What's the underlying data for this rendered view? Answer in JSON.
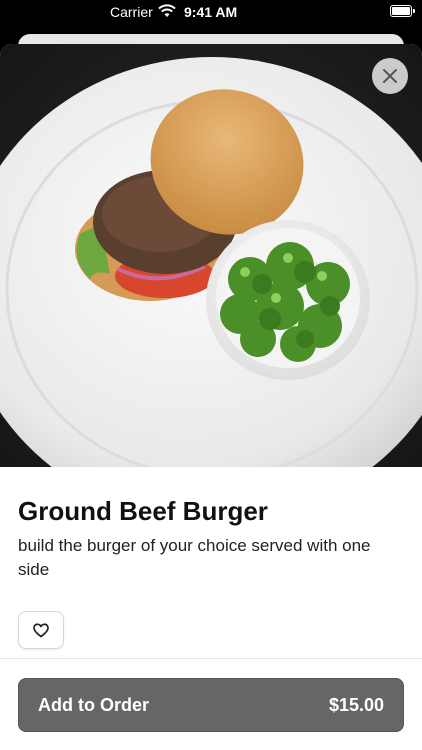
{
  "status_bar": {
    "carrier": "Carrier",
    "time": "9:41 AM"
  },
  "item": {
    "title": "Ground Beef Burger",
    "description": "build the burger of your choice served with one side",
    "image_alt": "burger with broccoli on plate"
  },
  "actions": {
    "add_label": "Add to Order",
    "price": "$15.00"
  },
  "icons": {
    "close": "close-icon",
    "favorite": "heart-icon",
    "wifi": "wifi-icon",
    "battery": "battery-icon"
  },
  "colors": {
    "order_button": "#666666",
    "background": "#000000",
    "sheet": "#ffffff"
  }
}
